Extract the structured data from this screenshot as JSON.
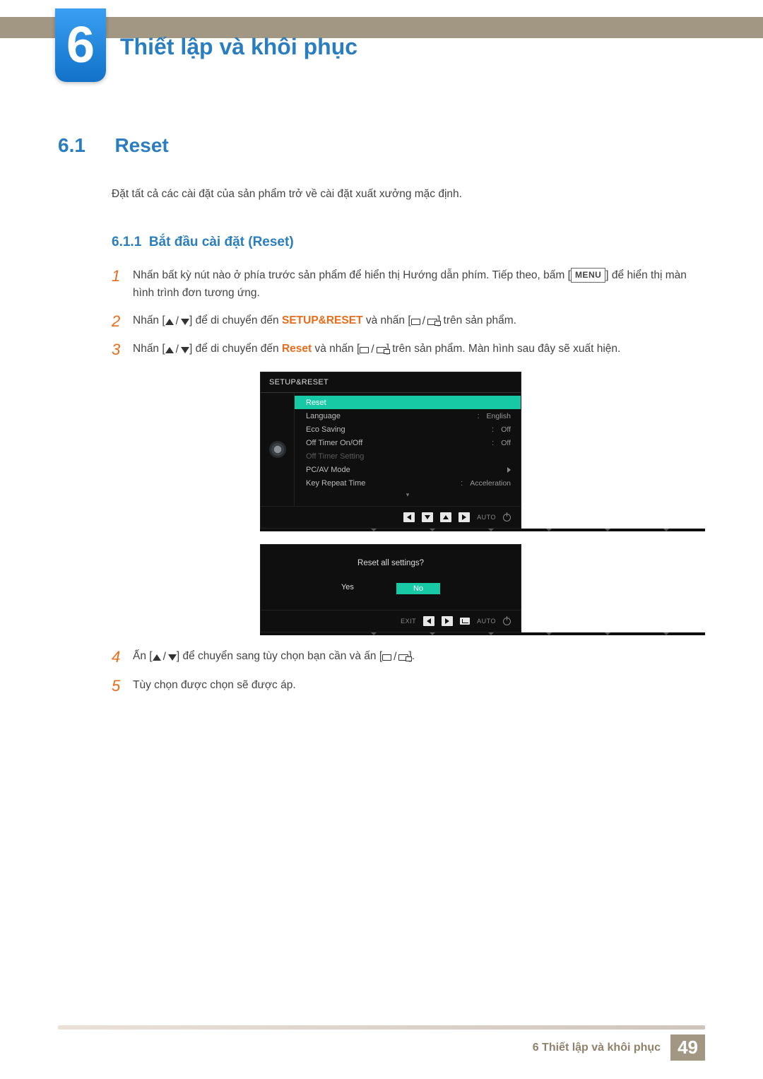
{
  "chapter": {
    "number": "6",
    "title": "Thiết lập và khôi phục"
  },
  "section": {
    "number": "6.1",
    "title": "Reset",
    "intro": "Đặt tất cả các cài đặt của sản phẩm trở về cài đặt xuất xưởng mặc định."
  },
  "subsection": {
    "number": "6.1.1",
    "title": "Bắt đầu cài đặt (Reset)"
  },
  "steps": {
    "s1a": "Nhấn bất kỳ nút nào ở phía trước sản phẩm để hiển thị Hướng dẫn phím. Tiếp theo, bấm [",
    "s1b": "] để hiển thị màn hình trình đơn tương ứng.",
    "menu": "MENU",
    "s2a": "Nhấn [",
    "s2b": "] để di chuyển đến ",
    "s2c": "SETUP&RESET",
    "s2d": " và nhấn [",
    "s2e": "] trên sản phẩm.",
    "s3a": "Nhấn [",
    "s3b": "] để di chuyển đến ",
    "s3c": "Reset",
    "s3d": " và nhấn [",
    "s3e": "] trên sản phẩm. Màn hình sau đây sẽ xuất hiện.",
    "s4a": "Ấn [",
    "s4b": "] để chuyển sang tùy chọn bạn cần và ấn [",
    "s4c": "].",
    "s5": "Tùy chọn được chọn sẽ được áp."
  },
  "osd": {
    "title": "SETUP&RESET",
    "rows": [
      {
        "label": "Reset",
        "val": "",
        "sel": true
      },
      {
        "label": "Language",
        "val": "English"
      },
      {
        "label": "Eco Saving",
        "val": "Off"
      },
      {
        "label": "Off Timer On/Off",
        "val": "Off"
      },
      {
        "label": "Off Timer Setting",
        "val": "",
        "disabled": true
      },
      {
        "label": "PC/AV Mode",
        "val": "",
        "arrow": true
      },
      {
        "label": "Key Repeat Time",
        "val": "Acceleration"
      }
    ],
    "auto": "AUTO"
  },
  "osd2": {
    "question": "Reset all settings?",
    "yes": "Yes",
    "no": "No",
    "exit": "EXIT",
    "auto": "AUTO"
  },
  "footer": {
    "chapter_label": "6 Thiết lập và khôi phục",
    "page": "49"
  }
}
